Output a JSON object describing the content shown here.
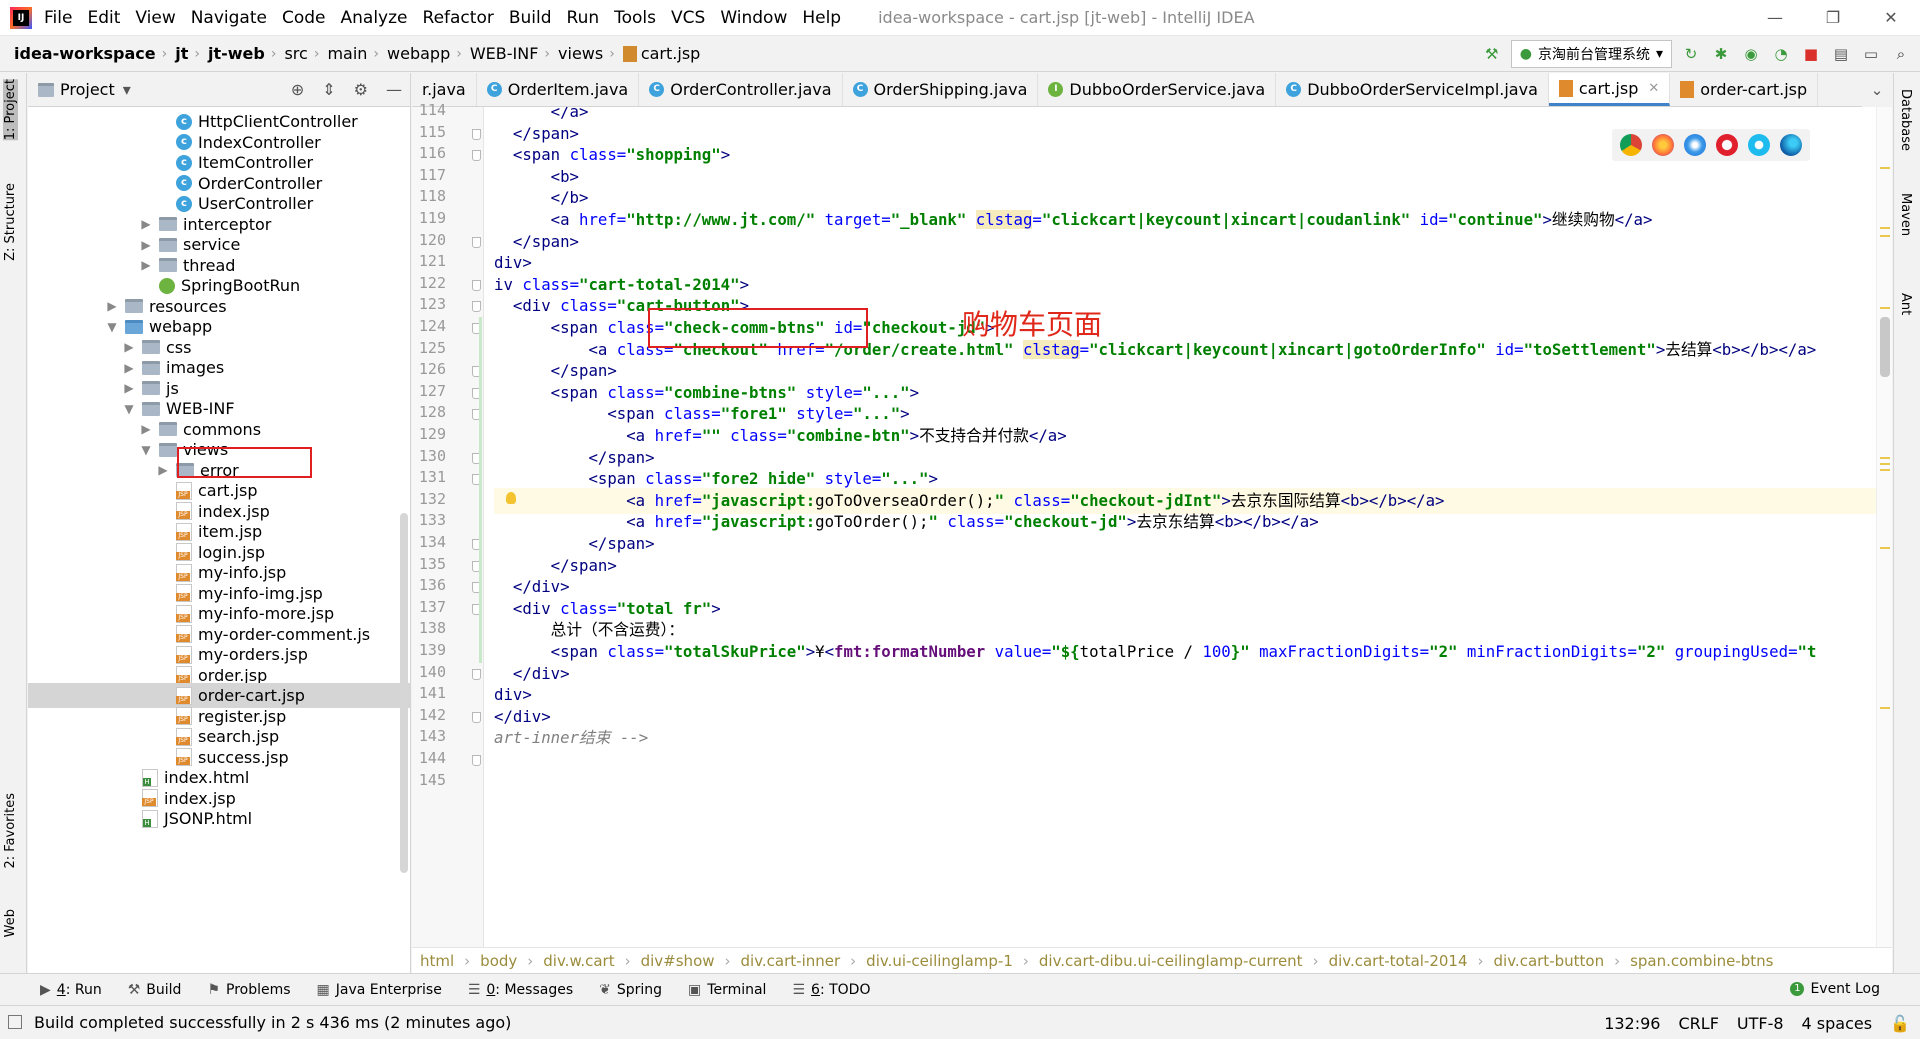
{
  "window": {
    "title": "idea-workspace - cart.jsp [jt-web] - IntelliJ IDEA",
    "menu": [
      "File",
      "Edit",
      "View",
      "Navigate",
      "Code",
      "Analyze",
      "Refactor",
      "Build",
      "Run",
      "Tools",
      "VCS",
      "Window",
      "Help"
    ],
    "controls": [
      "—",
      "❐",
      "✕"
    ]
  },
  "nav": {
    "breadcrumbs": [
      "idea-workspace",
      "jt",
      "jt-web",
      "src",
      "main",
      "webapp",
      "WEB-INF",
      "views",
      "cart.jsp"
    ],
    "run_config": "京淘前台管理系统"
  },
  "left_strip": {
    "project": "1: Project",
    "structure": "Z: Structure",
    "favorites": "2: Favorites",
    "web": "Web"
  },
  "right_strip": {
    "database": "Database",
    "maven": "Maven",
    "ant": "Ant"
  },
  "project_panel": {
    "title": "Project",
    "tree": [
      {
        "label": "HttpClientController",
        "icon": "class",
        "indent": 4
      },
      {
        "label": "IndexController",
        "icon": "class",
        "indent": 4
      },
      {
        "label": "ItemController",
        "icon": "class",
        "indent": 4
      },
      {
        "label": "OrderController",
        "icon": "class",
        "indent": 4
      },
      {
        "label": "UserController",
        "icon": "class",
        "indent": 4
      },
      {
        "label": "interceptor",
        "icon": "folder",
        "indent": 3,
        "arrow": "▶"
      },
      {
        "label": "service",
        "icon": "folder",
        "indent": 3,
        "arrow": "▶"
      },
      {
        "label": "thread",
        "icon": "folder",
        "indent": 3,
        "arrow": "▶"
      },
      {
        "label": "SpringBootRun",
        "icon": "spring",
        "indent": 3
      },
      {
        "label": "resources",
        "icon": "folder",
        "indent": 1,
        "arrow": "▶"
      },
      {
        "label": "webapp",
        "icon": "folder-blue",
        "indent": 1,
        "arrow": "▼"
      },
      {
        "label": "css",
        "icon": "folder",
        "indent": 2,
        "arrow": "▶"
      },
      {
        "label": "images",
        "icon": "folder",
        "indent": 2,
        "arrow": "▶"
      },
      {
        "label": "js",
        "icon": "folder",
        "indent": 2,
        "arrow": "▶"
      },
      {
        "label": "WEB-INF",
        "icon": "folder",
        "indent": 2,
        "arrow": "▼"
      },
      {
        "label": "commons",
        "icon": "folder",
        "indent": 3,
        "arrow": "▶"
      },
      {
        "label": "views",
        "icon": "folder",
        "indent": 3,
        "arrow": "▼"
      },
      {
        "label": "error",
        "icon": "folder",
        "indent": 4,
        "arrow": "▶"
      },
      {
        "label": "cart.jsp",
        "icon": "jsp",
        "indent": 4
      },
      {
        "label": "index.jsp",
        "icon": "jsp",
        "indent": 4
      },
      {
        "label": "item.jsp",
        "icon": "jsp",
        "indent": 4
      },
      {
        "label": "login.jsp",
        "icon": "jsp",
        "indent": 4
      },
      {
        "label": "my-info.jsp",
        "icon": "jsp",
        "indent": 4
      },
      {
        "label": "my-info-img.jsp",
        "icon": "jsp",
        "indent": 4
      },
      {
        "label": "my-info-more.jsp",
        "icon": "jsp",
        "indent": 4
      },
      {
        "label": "my-order-comment.js",
        "icon": "jsp",
        "indent": 4
      },
      {
        "label": "my-orders.jsp",
        "icon": "jsp",
        "indent": 4
      },
      {
        "label": "order.jsp",
        "icon": "jsp",
        "indent": 4
      },
      {
        "label": "order-cart.jsp",
        "icon": "jsp",
        "indent": 4,
        "selected": true
      },
      {
        "label": "register.jsp",
        "icon": "jsp",
        "indent": 4
      },
      {
        "label": "search.jsp",
        "icon": "jsp",
        "indent": 4
      },
      {
        "label": "success.jsp",
        "icon": "jsp",
        "indent": 4
      },
      {
        "label": "index.html",
        "icon": "html",
        "indent": 2
      },
      {
        "label": "index.jsp",
        "icon": "jsp",
        "indent": 2
      },
      {
        "label": "JSONP.html",
        "icon": "html",
        "indent": 2
      }
    ]
  },
  "editor": {
    "tabs": [
      {
        "label": "r.java",
        "icon": "none"
      },
      {
        "label": "OrderItem.java",
        "icon": "c"
      },
      {
        "label": "OrderController.java",
        "icon": "c"
      },
      {
        "label": "OrderShipping.java",
        "icon": "c"
      },
      {
        "label": "DubboOrderService.java",
        "icon": "i"
      },
      {
        "label": "DubboOrderServiceImpl.java",
        "icon": "c"
      },
      {
        "label": "cart.jsp",
        "icon": "j",
        "active": true
      },
      {
        "label": "order-cart.jsp",
        "icon": "j"
      }
    ],
    "annotation": "购物车页面",
    "current_line": 132,
    "lines": [
      {
        "n": "114",
        "html": "      <span class=\"tg\">&lt;/a&gt;</span>"
      },
      {
        "n": "115",
        "html": "  <span class=\"tg\">&lt;/span&gt;</span>"
      },
      {
        "n": "116",
        "html": "  <span class=\"tg\">&lt;span </span><span class=\"at\">class=</span><span class=\"av\">\"shopping\"</span><span class=\"tg\">&gt;</span>"
      },
      {
        "n": "117",
        "html": "      <span class=\"tg\">&lt;b&gt;</span>"
      },
      {
        "n": "118",
        "html": "      <span class=\"tg\">&lt;/b&gt;</span>"
      },
      {
        "n": "119",
        "html": "      <span class=\"tg\">&lt;a </span><span class=\"at\">href=</span><span class=\"av\">\"http://www.jt.com/\"</span> <span class=\"at\">target=</span><span class=\"av\">\"_blank\"</span> <span class=\"at warn-attr\">clstag</span><span class=\"at\">=</span><span class=\"av\">\"clickcart|keycount|xincart|coudanlink\"</span> <span class=\"at\">id=</span><span class=\"av\">\"continue\"</span><span class=\"tg\">&gt;</span>继续购物<span class=\"tg\">&lt;/a&gt;</span>"
      },
      {
        "n": "120",
        "html": "  <span class=\"tg\">&lt;/span&gt;</span>"
      },
      {
        "n": "121",
        "html": "<span class=\"tg\">div&gt;</span>"
      },
      {
        "n": "122",
        "html": "<span class=\"tg\">iv </span><span class=\"at\">class=</span><span class=\"av\">\"cart-total-2014\"</span><span class=\"tg\">&gt;</span>"
      },
      {
        "n": "123",
        "html": "  <span class=\"tg\">&lt;div </span><span class=\"at\">class=</span><span class=\"av\">\"cart-button\"</span><span class=\"tg\">&gt;</span>"
      },
      {
        "n": "124",
        "html": "      <span class=\"tg\">&lt;span </span><span class=\"at\">class=</span><span class=\"av\">\"check-comm-btns\"</span> <span class=\"at\">id=</span><span class=\"av\">\"checkout-jd\"</span><span class=\"tg\">&gt;</span>"
      },
      {
        "n": "125",
        "html": "          <span class=\"tg\">&lt;a </span><span class=\"at\">class=</span><span class=\"av\">\"checkout\"</span> <span class=\"at\">href=</span><span class=\"av\">\"/order/create.html\"</span> <span class=\"at warn-attr\">clstag</span><span class=\"at\">=</span><span class=\"av\">\"clickcart|keycount|xincart|gotoOrderInfo\"</span> <span class=\"at\">id=</span><span class=\"av\">\"toSettlement\"</span><span class=\"tg\">&gt;</span>去结算<span class=\"tg\">&lt;b&gt;&lt;/b&gt;&lt;/a&gt;</span>"
      },
      {
        "n": "126",
        "html": "      <span class=\"tg\">&lt;/span&gt;</span>"
      },
      {
        "n": "127",
        "html": "      <span class=\"tg\">&lt;span </span><span class=\"at\">class=</span><span class=\"av\">\"combine-btns\"</span> <span class=\"at\">style=</span><span class=\"av\">\"...\"</span><span class=\"tg\">&gt;</span>"
      },
      {
        "n": "128",
        "html": "            <span class=\"tg\">&lt;span </span><span class=\"at\">class=</span><span class=\"av\">\"fore1\"</span> <span class=\"at\">style=</span><span class=\"av\">\"...\"</span><span class=\"tg\">&gt;</span>"
      },
      {
        "n": "129",
        "html": "              <span class=\"tg\">&lt;a </span><span class=\"at\">href=</span><span class=\"av\">\"\"</span> <span class=\"at\">class=</span><span class=\"av\">\"combine-btn\"</span><span class=\"tg\">&gt;</span>不支持合并付款<span class=\"tg\">&lt;/a&gt;</span>"
      },
      {
        "n": "130",
        "html": "          <span class=\"tg\">&lt;/span&gt;</span>"
      },
      {
        "n": "131",
        "html": "          <span class=\"tg\">&lt;span </span><span class=\"at\">class=</span><span class=\"av\">\"fore2 hide\"</span> <span class=\"at\">style=</span><span class=\"av\">\"...\"</span><span class=\"tg\">&gt;</span>"
      },
      {
        "n": "132",
        "html": "              <span class=\"tg\">&lt;a </span><span class=\"at\">href=</span><span class=\"av\">\"javascript:</span><span class=\"js\">goToOverseaOrder();</span><span class=\"av\">\"</span> <span class=\"at\">class=</span><span class=\"av\">\"checkout-jdInt\"</span><span class=\"tg\">&gt;</span>去京东国际结算<span class=\"tg\">&lt;b&gt;&lt;/b&gt;&lt;/a&gt;</span>"
      },
      {
        "n": "133",
        "html": "              <span class=\"tg\">&lt;a </span><span class=\"at\">href=</span><span class=\"av\">\"javascript:</span><span class=\"js\">goToOrder();</span><span class=\"av\">\"</span> <span class=\"at\">class=</span><span class=\"av\">\"checkout-jd\"</span><span class=\"tg\">&gt;</span>去京东结算<span class=\"tg\">&lt;b&gt;&lt;/b&gt;&lt;/a&gt;</span>"
      },
      {
        "n": "134",
        "html": "          <span class=\"tg\">&lt;/span&gt;</span>"
      },
      {
        "n": "135",
        "html": "      <span class=\"tg\">&lt;/span&gt;</span>"
      },
      {
        "n": "136",
        "html": "  <span class=\"tg\">&lt;/div&gt;</span>"
      },
      {
        "n": "137",
        "html": "  <span class=\"tg\">&lt;div </span><span class=\"at\">class=</span><span class=\"av\">\"total fr\"</span><span class=\"tg\">&gt;</span>"
      },
      {
        "n": "138",
        "html": "      总计（不含运费）："
      },
      {
        "n": "139",
        "html": "      <span class=\"tg\">&lt;span </span><span class=\"at\">class=</span><span class=\"av\">\"totalSkuPrice\"</span><span class=\"tg\">&gt;</span>¥<span class=\"tg\">&lt;</span><span class=\"kw\">fmt:formatNumber</span> <span class=\"at\">value=</span><span class=\"av\">\"${</span>totalPrice / <span class=\"at\">100</span><span class=\"av\">}\"</span> <span class=\"at\">maxFractionDigits=</span><span class=\"av\">\"2\"</span> <span class=\"at\">minFractionDigits=</span><span class=\"av\">\"2\"</span> <span class=\"at\">groupingUsed=</span><span class=\"av\">\"t</span>"
      },
      {
        "n": "140",
        "html": "  <span class=\"tg\">&lt;/div&gt;</span>"
      },
      {
        "n": "141",
        "html": "<span class=\"tg\">div&gt;</span>"
      },
      {
        "n": "142",
        "html": "<span class=\"tg\">&lt;/div&gt;</span>"
      },
      {
        "n": "143",
        "html": "<span class=\"cm\">art-inner结束 --&gt;</span>"
      },
      {
        "n": "144",
        "html": ""
      },
      {
        "n": "145",
        "html": ""
      }
    ],
    "breadcrumb": [
      "html",
      "body",
      "div.w.cart",
      "div#show",
      "div.cart-inner",
      "div.ui-ceilinglamp-1",
      "div.cart-dibu.ui-ceilinglamp-current",
      "div.cart-total-2014",
      "div.cart-button",
      "span.combine-btns"
    ]
  },
  "toolwindows": [
    {
      "key": "4",
      "label": ": Run",
      "icon": "▶"
    },
    {
      "key": "",
      "label": "Build",
      "icon": "⚒"
    },
    {
      "key": "",
      "label": "Problems",
      "icon": "⚑"
    },
    {
      "key": "",
      "label": "Java Enterprise",
      "icon": "▦"
    },
    {
      "key": "0",
      "label": ": Messages",
      "icon": "☰"
    },
    {
      "key": "",
      "label": "Spring",
      "icon": "❦"
    },
    {
      "key": "",
      "label": "Terminal",
      "icon": "▣"
    },
    {
      "key": "6",
      "label": ": TODO",
      "icon": "☰"
    }
  ],
  "event_log": "Event Log",
  "status": {
    "message": "Build completed successfully in 2 s 436 ms (2 minutes ago)",
    "position": "132:96",
    "line_sep": "CRLF",
    "encoding": "UTF-8",
    "indent": "4 spaces"
  },
  "colors": {
    "annotation_red": "#e0281a",
    "highlight_box": "#e02020",
    "tab_active_underline": "#4083c9"
  }
}
